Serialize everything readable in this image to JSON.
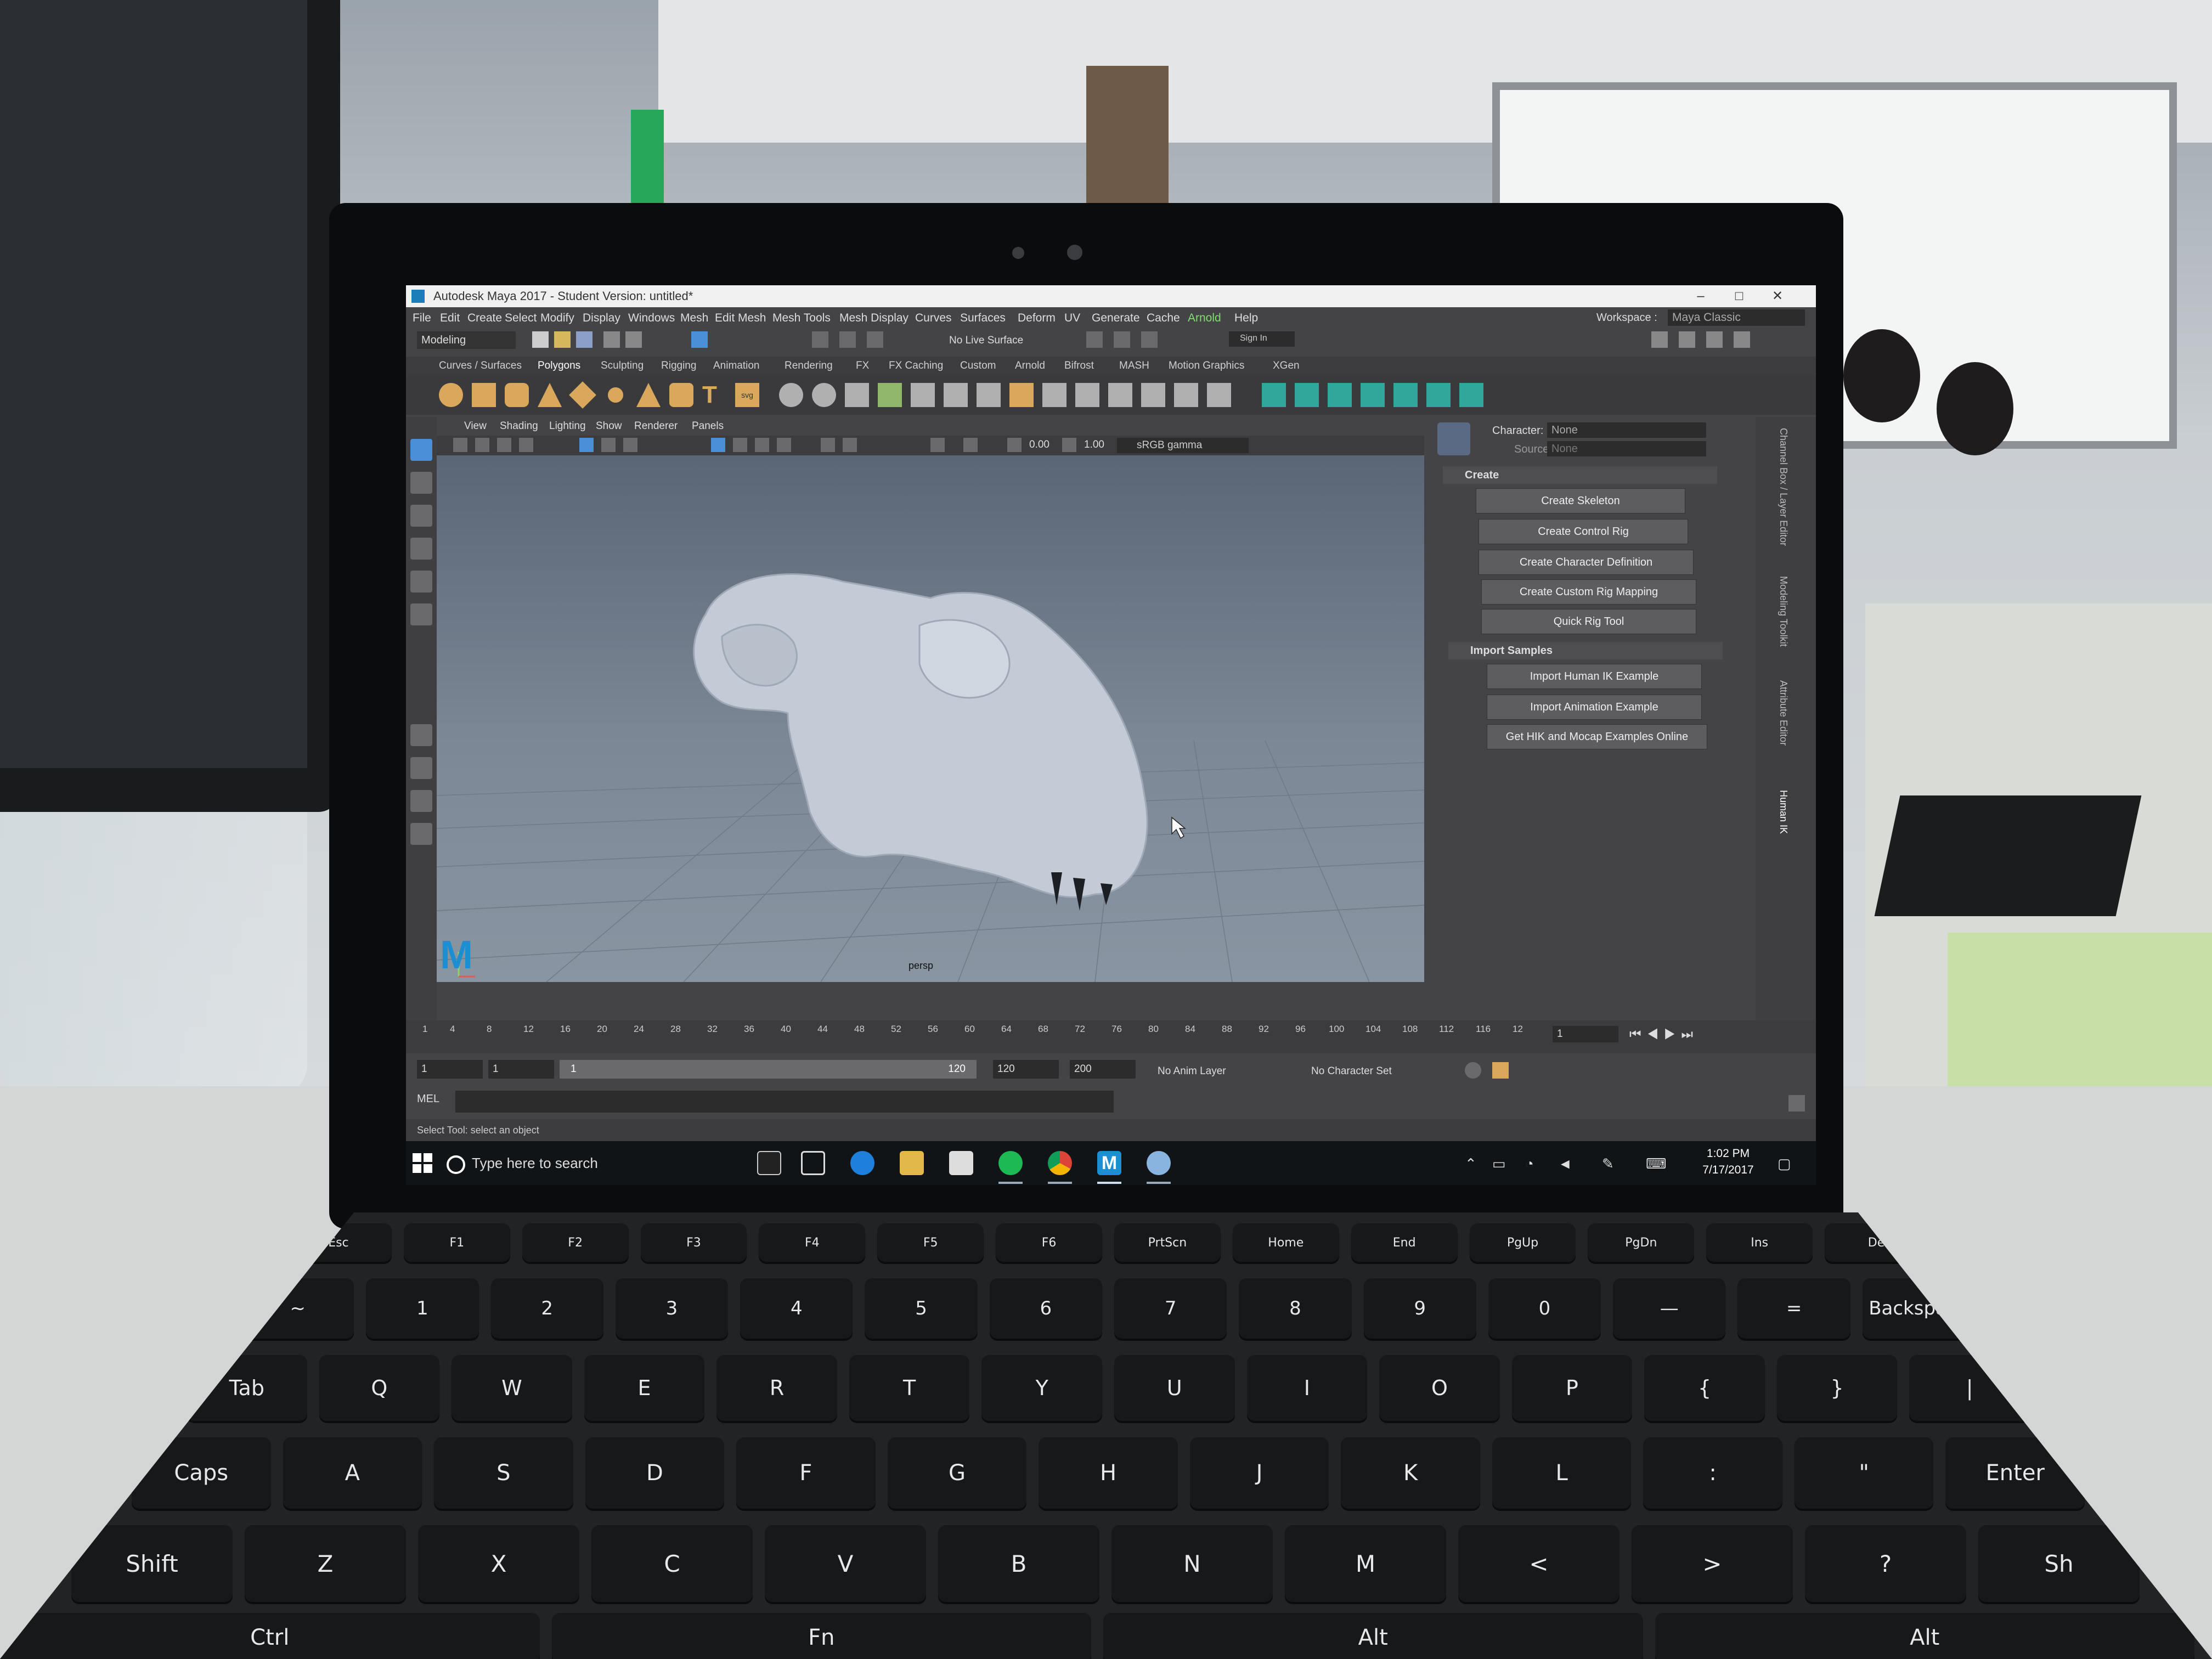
{
  "window": {
    "title": "Autodesk Maya 2017 - Student Version: untitled*",
    "workspace_label": "Workspace :",
    "workspace_value": "Maya Classic"
  },
  "menubar": [
    "File",
    "Edit",
    "Create",
    "Select",
    "Modify",
    "Display",
    "Windows",
    "Mesh",
    "Edit Mesh",
    "Mesh Tools",
    "Mesh Display",
    "Curves",
    "Surfaces",
    "Deform",
    "UV",
    "Generate",
    "Cache",
    "Arnold",
    "Help"
  ],
  "statusline": {
    "mode": "Modeling",
    "live_surface": "No Live Surface",
    "sign_in": "Sign In"
  },
  "shelf_tabs": [
    "Curves / Surfaces",
    "Polygons",
    "Sculpting",
    "Rigging",
    "Animation",
    "Rendering",
    "FX",
    "FX Caching",
    "Custom",
    "Arnold",
    "Bifrost",
    "MASH",
    "Motion Graphics",
    "XGen"
  ],
  "shelf_selected": "Polygons",
  "viewport": {
    "menu": [
      "View",
      "Shading",
      "Lighting",
      "Show",
      "Renderer",
      "Panels"
    ],
    "exposure": "0.00",
    "gamma_value": "1.00",
    "color_space": "sRGB gamma",
    "camera_label": "persp"
  },
  "hik": {
    "character_label": "Character:",
    "character_value": "None",
    "source_label": "Source:",
    "source_value": "None",
    "create_section": "Create",
    "create_buttons": [
      "Create Skeleton",
      "Create Control Rig",
      "Create Character Definition",
      "Create Custom Rig Mapping",
      "Quick Rig Tool"
    ],
    "import_section": "Import Samples",
    "import_buttons": [
      "Import Human IK Example",
      "Import Animation Example",
      "Get HIK and Mocap Examples Online"
    ],
    "side_tabs": [
      "Channel Box / Layer Editor",
      "Modeling Toolkit",
      "Attribute Editor",
      "Human IK"
    ]
  },
  "timeslider": {
    "ticks": [
      "1",
      "4",
      "8",
      "12",
      "16",
      "20",
      "24",
      "28",
      "32",
      "36",
      "40",
      "44",
      "48",
      "52",
      "56",
      "60",
      "64",
      "68",
      "72",
      "76",
      "80",
      "84",
      "88",
      "92",
      "96",
      "100",
      "104",
      "108",
      "112",
      "116",
      "12"
    ],
    "current_frame": "1"
  },
  "rangebar": {
    "start": "1",
    "playback_start": "1",
    "range_start": "1",
    "range_end": "120",
    "playback_end": "120",
    "end": "200",
    "anim_layer": "No Anim Layer",
    "character_set": "No Character Set"
  },
  "command": {
    "mel": "MEL",
    "help": "Select Tool: select an object"
  },
  "taskbar": {
    "search_placeholder": "Type here to search",
    "time": "1:02 PM",
    "date": "7/17/2017"
  },
  "keyboard": {
    "fn_row": [
      "Esc",
      "F1",
      "F2",
      "F3",
      "F4",
      "F5",
      "F6",
      "PrtScn",
      "Home",
      "End",
      "PgUp",
      "PgDn",
      "Ins",
      "Del"
    ],
    "num_row": [
      "~",
      "1",
      "2",
      "3",
      "4",
      "5",
      "6",
      "7",
      "8",
      "9",
      "0",
      "—",
      "=",
      "Backspace"
    ],
    "row_q": [
      "Tab",
      "Q",
      "W",
      "E",
      "R",
      "T",
      "Y",
      "U",
      "I",
      "O",
      "P",
      "{",
      "}",
      "|"
    ],
    "row_a": [
      "Caps",
      "A",
      "S",
      "D",
      "F",
      "G",
      "H",
      "J",
      "K",
      "L",
      ":",
      "\"",
      "Enter"
    ],
    "row_z": [
      "Shift",
      "Z",
      "X",
      "C",
      "V",
      "B",
      "N",
      "M",
      "<",
      ">",
      "?",
      "Sh"
    ],
    "row_bottom": [
      "Ctrl",
      "Fn",
      "Alt",
      "Alt"
    ]
  },
  "colors": {
    "maya_bg": "#444446",
    "maya_accent": "#1b8fd1",
    "arnold_green": "#7fde6d",
    "mesh": "#c4cbd6"
  }
}
